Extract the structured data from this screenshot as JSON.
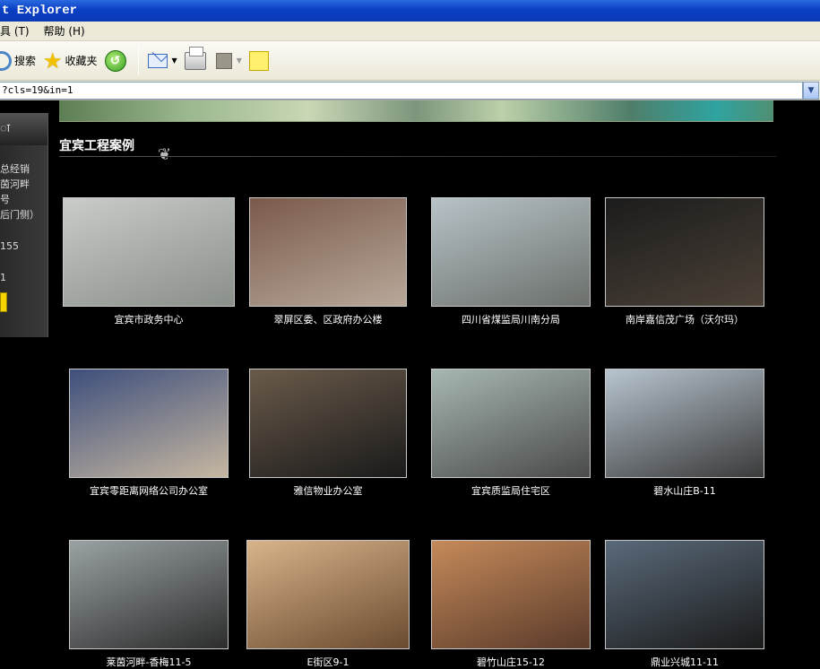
{
  "window": {
    "title": "t Explorer"
  },
  "menu": {
    "items": [
      "具 (T)",
      "帮助 (H)"
    ]
  },
  "toolbar": {
    "search_label": "搜索",
    "favorites_label": "收藏夹"
  },
  "address": {
    "url": "?cls=19&in=1"
  },
  "sidebar": {
    "lines_top": [
      "总经销",
      "茵河畔",
      "号",
      "后门侧）"
    ],
    "line_mid": "155",
    "line_low": "1"
  },
  "page": {
    "section_title": "宜宾工程案例"
  },
  "cases": [
    {
      "caption": "宜宾市政务中心",
      "colors": [
        "#c9ccc8",
        "#8a8f8a"
      ]
    },
    {
      "caption": "翠屏区委、区政府办公楼",
      "colors": [
        "#7a5a4a",
        "#b8a89a"
      ]
    },
    {
      "caption": "四川省煤监局川南分局",
      "colors": [
        "#b7c3c8",
        "#6b6f6b"
      ]
    },
    {
      "caption": "南岸嘉信茂广场（沃尔玛）",
      "colors": [
        "#1c1c1c",
        "#4a4036"
      ]
    },
    {
      "caption": "宜宾零距离网络公司办公室",
      "colors": [
        "#3e4f7c",
        "#c6b7a1"
      ]
    },
    {
      "caption": "雅信物业办公室",
      "colors": [
        "#6a5a4a",
        "#1a1a1a"
      ]
    },
    {
      "caption": "宜宾质监局住宅区",
      "colors": [
        "#a7b7b2",
        "#4a4a4a"
      ]
    },
    {
      "caption": "碧水山庄B-11",
      "colors": [
        "#b7c4cf",
        "#3a3a3a"
      ]
    },
    {
      "caption": "莱茵河畔-香梅11-5",
      "colors": [
        "#9aa2a4",
        "#2c2c2c"
      ]
    },
    {
      "caption": "E街区9-1",
      "colors": [
        "#d8b48a",
        "#6a4a30"
      ]
    },
    {
      "caption": "碧竹山庄15-12",
      "colors": [
        "#c58a5a",
        "#5a3a2a"
      ]
    },
    {
      "caption": "鼎业兴城11-11",
      "colors": [
        "#5a6a7a",
        "#1a1a1a"
      ]
    }
  ]
}
